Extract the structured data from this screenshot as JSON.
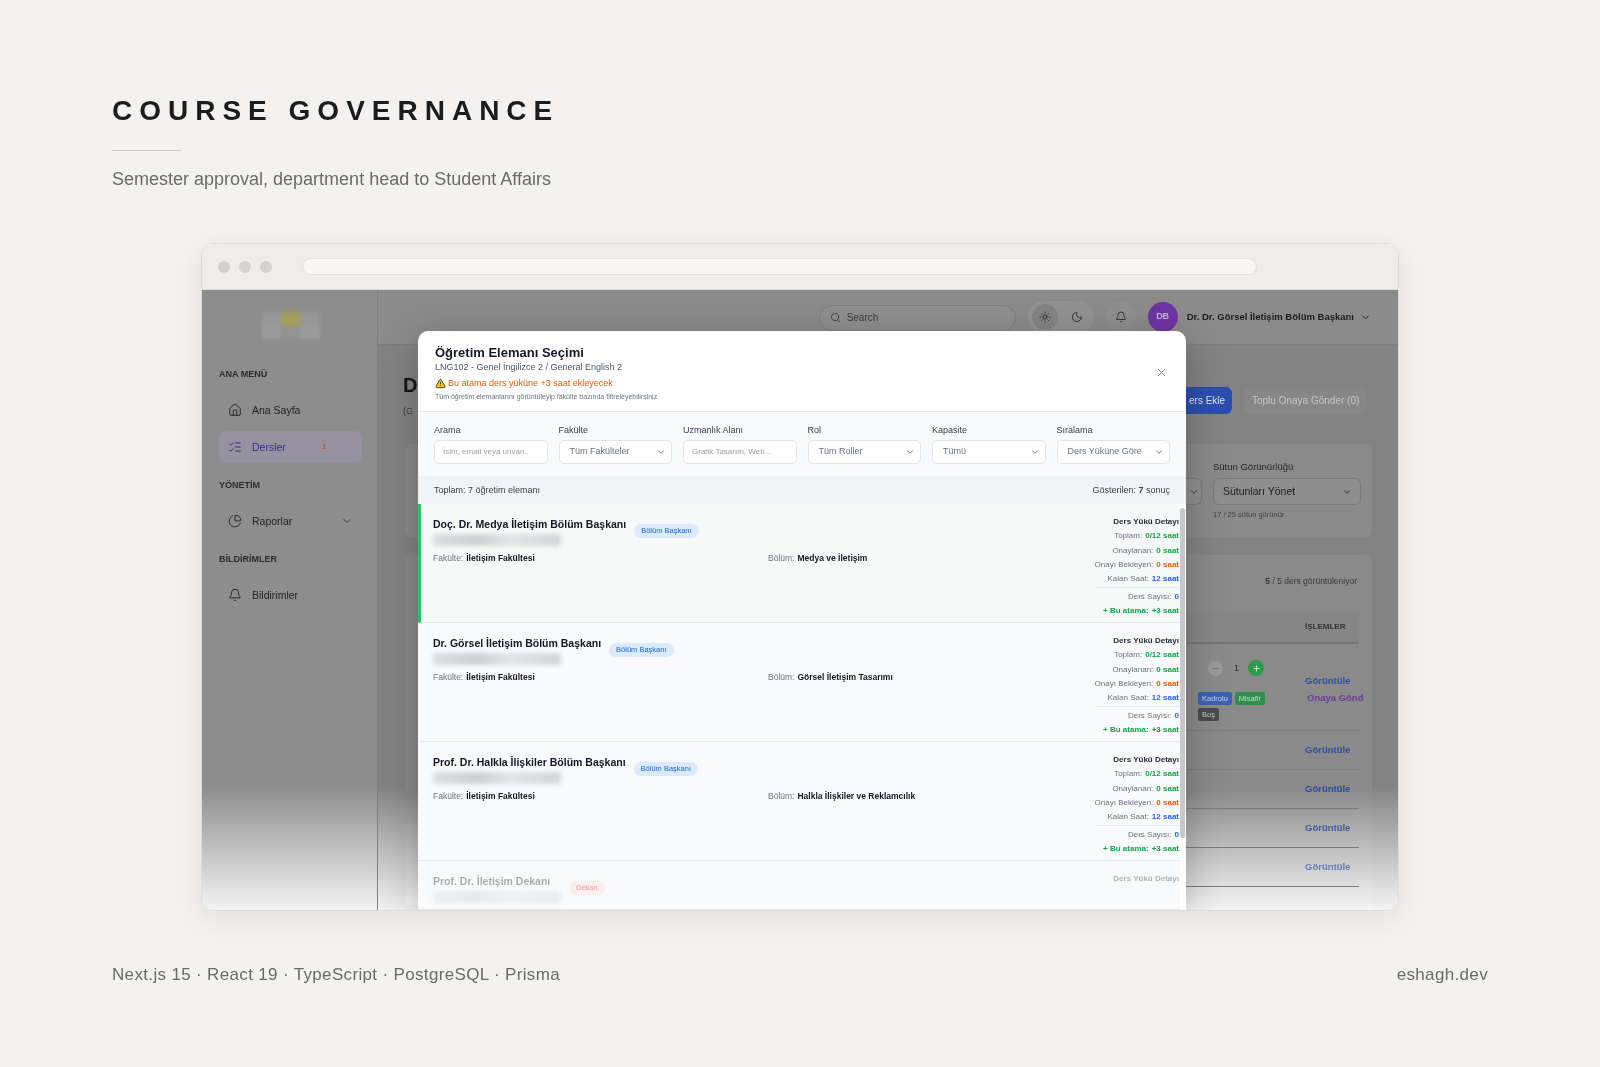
{
  "page": {
    "title": "COURSE GOVERNANCE",
    "subtitle": "Semester approval, department head to Student Affairs"
  },
  "app": {
    "sidebar": {
      "sections": [
        {
          "heading": "ANA MENÜ",
          "items": [
            {
              "label": "Ana Sayfa",
              "selected": false
            },
            {
              "label": "Dersler",
              "selected": true,
              "badge": "1"
            }
          ]
        },
        {
          "heading": "YÖNETİM",
          "items": [
            {
              "label": "Raporlar",
              "selected": false,
              "expanded": false
            }
          ]
        },
        {
          "heading": "BİLDİRİMLER",
          "items": [
            {
              "label": "Bildirimler",
              "selected": false
            }
          ]
        }
      ]
    },
    "header": {
      "search": {
        "placeholder": "Search"
      },
      "theme_options": [
        {
          "kind": "light",
          "selected": true
        },
        {
          "kind": "dark",
          "selected": false
        }
      ],
      "user": {
        "initials": "DB",
        "name": "Dr. Dr. Görsel İletişim Bölüm Başkanı"
      }
    },
    "content": {
      "heading": "D",
      "subheading": "(G",
      "buttons": [
        {
          "label": "ers Ekle",
          "kind": "primary",
          "disabled": false
        },
        {
          "label": "Toplu Onaya Gönder (0)",
          "kind": "secondary",
          "disabled": true
        }
      ],
      "column_visibility": {
        "label": "Sütun Görünürlüğü",
        "value": "Sütunları Yönet",
        "hint": "17 / 25 sütun görünür"
      },
      "table": {
        "count": "**5** / 5 ders görüntüleniyor",
        "actions_header": "İŞLEMLER",
        "rows": [
          {
            "quantity": "1",
            "tags": [
              {
                "label": "Kadrolu",
                "color": "#3c62b0"
              },
              {
                "label": "Misafir",
                "color": "#2f8f4c"
              },
              {
                "label": "Boş",
                "color": "#4b4b4b"
              }
            ],
            "actions": [
              {
                "label": "Görüntüle",
                "kind": "view"
              },
              {
                "label": "Onaya Gönd",
                "kind": "submit"
              }
            ]
          },
          {
            "actions": [
              {
                "label": "Görüntüle",
                "kind": "view"
              }
            ]
          },
          {
            "actions": [
              {
                "label": "Görüntüle",
                "kind": "view"
              }
            ]
          },
          {
            "actions": [
              {
                "label": "Görüntüle",
                "kind": "view"
              }
            ]
          },
          {
            "actions": [
              {
                "label": "Görüntüle",
                "kind": "view"
              }
            ]
          }
        ]
      }
    }
  },
  "modal": {
    "title": "Öğretim Elemanı Seçimi",
    "course": "LNG102 - Genel İngilizce 2 / General English 2",
    "warning": "Bu atama ders yüküne +3 saat ekleyecek",
    "note": "Tüm öğretim elemanlarını görüntüleyip fakülte bazında filtreleyebilirsiniz",
    "filters": [
      {
        "label": "Arama",
        "kind": "text",
        "placeholder": "İsim, email veya unvan.."
      },
      {
        "label": "Fakülte",
        "kind": "select",
        "value": "Tüm Fakülteler"
      },
      {
        "label": "Uzmanlık Alanı",
        "kind": "text",
        "placeholder": "Grafik Tasarım, Web..."
      },
      {
        "label": "Rol",
        "kind": "select",
        "value": "Tüm Roller"
      },
      {
        "label": "Kapasite",
        "kind": "select",
        "value": "Tümü"
      },
      {
        "label": "Sıralama",
        "kind": "select",
        "value": "Ders Yüküne Göre"
      }
    ],
    "summary": {
      "total": "Toplam: 7 öğretim elemanı",
      "shown": "Gösterilen: **7** sonuç"
    },
    "instructors": [
      {
        "name": "Doç. Dr. Medya İletişim Bölüm Başkanı",
        "role": {
          "label": "Bölüm Başkanı",
          "color": "#dbeafe"
        },
        "selected": true,
        "details": [
          {
            "label": "Fakülte:",
            "value": "İletişim Fakültesi"
          },
          {
            "label": "Bölüm:",
            "value": "Medya ve İletişim"
          }
        ],
        "load": {
          "title": "Ders Yükü Detayı",
          "hours": [
            {
              "label": "Toplam:",
              "value": "0/12 saat",
              "color": "#16a34a"
            },
            {
              "label": "Onaylanan:",
              "value": "0 saat",
              "color": "#16a34a"
            },
            {
              "label": "Onayı Bekleyen:",
              "value": "0 saat",
              "color": "#ea580c"
            },
            {
              "label": "Kalan Saat:",
              "value": "12 saat",
              "color": "#2563eb"
            }
          ],
          "extra": [
            {
              "label": "Ders Sayısı:",
              "value": "0",
              "color": "#2563eb",
              "kind": "plain"
            },
            {
              "label": "+ Bu atama:",
              "value": "+3 saat",
              "color": "#16a34a",
              "kind": "accent"
            }
          ]
        }
      },
      {
        "name": "Dr. Görsel İletişim Bölüm Başkanı",
        "role": {
          "label": "Bölüm Başkanı",
          "color": "#dbeafe"
        },
        "selected": false,
        "details": [
          {
            "label": "Fakülte:",
            "value": "İletişim Fakültesi"
          },
          {
            "label": "Bölüm:",
            "value": "Görsel İletişim Tasarımı"
          }
        ],
        "load": {
          "title": "Ders Yükü Detayı",
          "hours": [
            {
              "label": "Toplam:",
              "value": "0/12 saat",
              "color": "#16a34a"
            },
            {
              "label": "Onaylanan:",
              "value": "0 saat",
              "color": "#16a34a"
            },
            {
              "label": "Onayı Bekleyen:",
              "value": "0 saat",
              "color": "#ea580c"
            },
            {
              "label": "Kalan Saat:",
              "value": "12 saat",
              "color": "#2563eb"
            }
          ],
          "extra": [
            {
              "label": "Ders Sayısı:",
              "value": "0",
              "color": "#2563eb",
              "kind": "plain"
            },
            {
              "label": "+ Bu atama:",
              "value": "+3 saat",
              "color": "#16a34a",
              "kind": "accent"
            }
          ]
        }
      },
      {
        "name": "Prof. Dr. Halkla İlişkiler Bölüm Başkanı",
        "role": {
          "label": "Bölüm Başkanı",
          "color": "#dbeafe"
        },
        "selected": false,
        "details": [
          {
            "label": "Fakülte:",
            "value": "İletişim Fakültesi"
          },
          {
            "label": "Bölüm:",
            "value": "Halkla İlişkiler ve Reklamcılık"
          }
        ],
        "load": {
          "title": "Ders Yükü Detayı",
          "hours": [
            {
              "label": "Toplam:",
              "value": "0/12 saat",
              "color": "#16a34a"
            },
            {
              "label": "Onaylanan:",
              "value": "0 saat",
              "color": "#16a34a"
            },
            {
              "label": "Onayı Bekleyen:",
              "value": "0 saat",
              "color": "#ea580c"
            },
            {
              "label": "Kalan Saat:",
              "value": "12 saat",
              "color": "#2563eb"
            }
          ],
          "extra": [
            {
              "label": "Ders Sayısı:",
              "value": "0",
              "color": "#2563eb",
              "kind": "plain"
            },
            {
              "label": "+ Bu atama:",
              "value": "+3 saat",
              "color": "#16a34a",
              "kind": "accent"
            }
          ]
        }
      },
      {
        "name": "Prof. Dr. İletişim Dekanı",
        "role": {
          "label": "Dekan",
          "color": "#fdeeee"
        },
        "selected": false,
        "load": {
          "title": "Ders Yükü Detayı"
        }
      }
    ]
  },
  "footer": {
    "stack": "Next.js 15 · React 19 · TypeScript · PostgreSQL · Prisma",
    "site": "eshagh.dev"
  }
}
